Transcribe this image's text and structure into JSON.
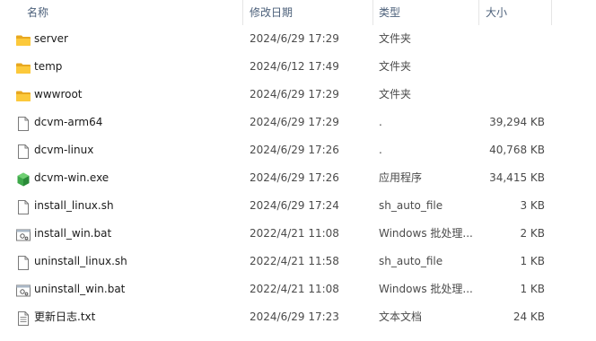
{
  "columns": {
    "name": "名称",
    "date": "修改日期",
    "type": "类型",
    "size": "大小"
  },
  "files": [
    {
      "name": "server",
      "date": "2024/6/29 17:29",
      "type": "文件夹",
      "size": "",
      "icon": "folder-icon"
    },
    {
      "name": "temp",
      "date": "2024/6/12 17:49",
      "type": "文件夹",
      "size": "",
      "icon": "folder-icon"
    },
    {
      "name": "wwwroot",
      "date": "2024/6/29 17:29",
      "type": "文件夹",
      "size": "",
      "icon": "folder-icon"
    },
    {
      "name": "dcvm-arm64",
      "date": "2024/6/29 17:29",
      "type": ".",
      "size": "39,294 KB",
      "icon": "file-icon"
    },
    {
      "name": "dcvm-linux",
      "date": "2024/6/29 17:26",
      "type": ".",
      "size": "40,768 KB",
      "icon": "file-icon"
    },
    {
      "name": "dcvm-win.exe",
      "date": "2024/6/29 17:26",
      "type": "应用程序",
      "size": "34,415 KB",
      "icon": "exe-icon"
    },
    {
      "name": "install_linux.sh",
      "date": "2024/6/29 17:24",
      "type": "sh_auto_file",
      "size": "3 KB",
      "icon": "file-icon"
    },
    {
      "name": "install_win.bat",
      "date": "2022/4/21 11:08",
      "type": "Windows 批处理...",
      "size": "2 KB",
      "icon": "bat-icon"
    },
    {
      "name": "uninstall_linux.sh",
      "date": "2022/4/21 11:58",
      "type": "sh_auto_file",
      "size": "1 KB",
      "icon": "file-icon"
    },
    {
      "name": "uninstall_win.bat",
      "date": "2022/4/21 11:08",
      "type": "Windows 批处理...",
      "size": "1 KB",
      "icon": "bat-icon"
    },
    {
      "name": "更新日志.txt",
      "date": "2024/6/29 17:23",
      "type": "文本文档",
      "size": "24 KB",
      "icon": "text-file-icon"
    }
  ]
}
